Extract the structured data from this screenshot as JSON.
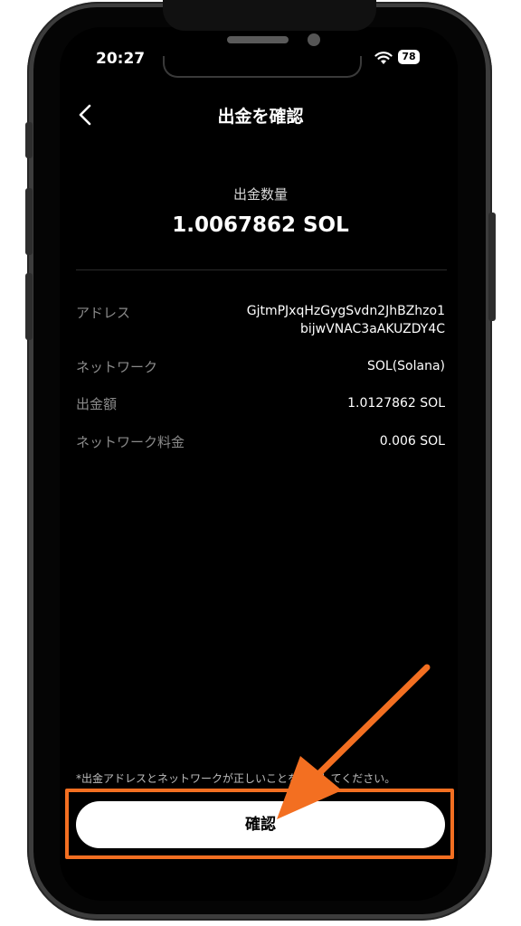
{
  "status_bar": {
    "time": "20:27",
    "battery": "78"
  },
  "header": {
    "title": "出金を確認"
  },
  "summary": {
    "amount_label": "出金数量",
    "amount_value": "1.0067862 SOL"
  },
  "details": [
    {
      "label": "アドレス",
      "value_line1": "GjtmPJxqHzGygSvdn2JhBZhzo1",
      "value_line2": "bijwVNAC3aAKUZDY4C"
    },
    {
      "label": "ネットワーク",
      "value": "SOL(Solana)"
    },
    {
      "label": "出金額",
      "value": "1.0127862 SOL"
    },
    {
      "label": "ネットワーク料金",
      "value": "0.006 SOL"
    }
  ],
  "notice": "*出金アドレスとネットワークが正しいことを確認してください。",
  "confirm_button": {
    "label": "確認"
  },
  "colors": {
    "annotation": "#f36f21",
    "background": "#000000",
    "button": "#ffffff"
  }
}
